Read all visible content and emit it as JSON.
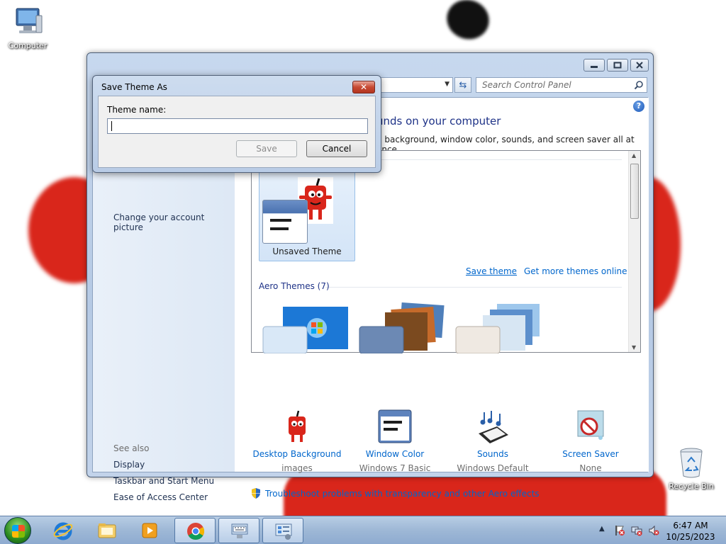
{
  "desktop": {
    "icons": [
      {
        "label": "Computer"
      },
      {
        "label": "Recycle Bin"
      }
    ]
  },
  "control_panel": {
    "search_placeholder": "Search Control Panel",
    "heading": "unds on your computer",
    "subheading": "p background, window color, sounds, and screen saver all at once.",
    "nav": {
      "partial_link": "Change your account picture",
      "see_also": "See also",
      "links": [
        "Display",
        "Taskbar and Start Menu",
        "Ease of Access Center"
      ]
    },
    "themes": {
      "unsaved_label": "Unsaved Theme",
      "save_theme": "Save theme",
      "get_more": "Get more themes online",
      "aero_header": "Aero Themes (7)"
    },
    "bottom": [
      {
        "title": "Desktop Background",
        "sub": "images"
      },
      {
        "title": "Window Color",
        "sub": "Windows 7 Basic"
      },
      {
        "title": "Sounds",
        "sub": "Windows Default"
      },
      {
        "title": "Screen Saver",
        "sub": "None"
      }
    ],
    "troubleshoot": "Troubleshoot problems with transparency and other Aero effects"
  },
  "dialog": {
    "title": "Save Theme As",
    "close_glyph": "✕",
    "label": "Theme name:",
    "input_value": "",
    "save_label": "Save",
    "cancel_label": "Cancel"
  },
  "taskbar": {
    "time": "6:47 AM",
    "date": "10/25/2023",
    "buttons": [
      "internet-explorer",
      "file-explorer",
      "media-player",
      "chrome",
      "keyboard",
      "control-panel"
    ]
  },
  "colors": {
    "accent_link": "#0066cc",
    "heading_blue": "#1e3287",
    "close_red": "#c74a33"
  }
}
